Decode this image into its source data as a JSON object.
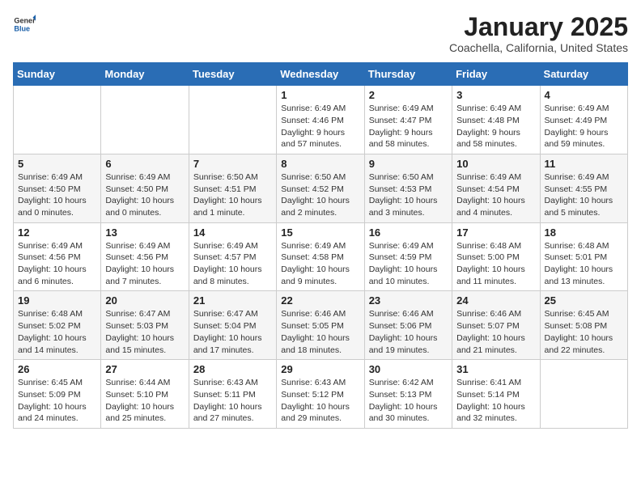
{
  "logo": {
    "general": "General",
    "blue": "Blue"
  },
  "header": {
    "month": "January 2025",
    "location": "Coachella, California, United States"
  },
  "weekdays": [
    "Sunday",
    "Monday",
    "Tuesday",
    "Wednesday",
    "Thursday",
    "Friday",
    "Saturday"
  ],
  "weeks": [
    [
      {
        "day": null
      },
      {
        "day": null
      },
      {
        "day": null
      },
      {
        "day": 1,
        "sunrise": "Sunrise: 6:49 AM",
        "sunset": "Sunset: 4:46 PM",
        "daylight": "Daylight: 9 hours and 57 minutes."
      },
      {
        "day": 2,
        "sunrise": "Sunrise: 6:49 AM",
        "sunset": "Sunset: 4:47 PM",
        "daylight": "Daylight: 9 hours and 58 minutes."
      },
      {
        "day": 3,
        "sunrise": "Sunrise: 6:49 AM",
        "sunset": "Sunset: 4:48 PM",
        "daylight": "Daylight: 9 hours and 58 minutes."
      },
      {
        "day": 4,
        "sunrise": "Sunrise: 6:49 AM",
        "sunset": "Sunset: 4:49 PM",
        "daylight": "Daylight: 9 hours and 59 minutes."
      }
    ],
    [
      {
        "day": 5,
        "sunrise": "Sunrise: 6:49 AM",
        "sunset": "Sunset: 4:50 PM",
        "daylight": "Daylight: 10 hours and 0 minutes."
      },
      {
        "day": 6,
        "sunrise": "Sunrise: 6:49 AM",
        "sunset": "Sunset: 4:50 PM",
        "daylight": "Daylight: 10 hours and 0 minutes."
      },
      {
        "day": 7,
        "sunrise": "Sunrise: 6:50 AM",
        "sunset": "Sunset: 4:51 PM",
        "daylight": "Daylight: 10 hours and 1 minute."
      },
      {
        "day": 8,
        "sunrise": "Sunrise: 6:50 AM",
        "sunset": "Sunset: 4:52 PM",
        "daylight": "Daylight: 10 hours and 2 minutes."
      },
      {
        "day": 9,
        "sunrise": "Sunrise: 6:50 AM",
        "sunset": "Sunset: 4:53 PM",
        "daylight": "Daylight: 10 hours and 3 minutes."
      },
      {
        "day": 10,
        "sunrise": "Sunrise: 6:49 AM",
        "sunset": "Sunset: 4:54 PM",
        "daylight": "Daylight: 10 hours and 4 minutes."
      },
      {
        "day": 11,
        "sunrise": "Sunrise: 6:49 AM",
        "sunset": "Sunset: 4:55 PM",
        "daylight": "Daylight: 10 hours and 5 minutes."
      }
    ],
    [
      {
        "day": 12,
        "sunrise": "Sunrise: 6:49 AM",
        "sunset": "Sunset: 4:56 PM",
        "daylight": "Daylight: 10 hours and 6 minutes."
      },
      {
        "day": 13,
        "sunrise": "Sunrise: 6:49 AM",
        "sunset": "Sunset: 4:56 PM",
        "daylight": "Daylight: 10 hours and 7 minutes."
      },
      {
        "day": 14,
        "sunrise": "Sunrise: 6:49 AM",
        "sunset": "Sunset: 4:57 PM",
        "daylight": "Daylight: 10 hours and 8 minutes."
      },
      {
        "day": 15,
        "sunrise": "Sunrise: 6:49 AM",
        "sunset": "Sunset: 4:58 PM",
        "daylight": "Daylight: 10 hours and 9 minutes."
      },
      {
        "day": 16,
        "sunrise": "Sunrise: 6:49 AM",
        "sunset": "Sunset: 4:59 PM",
        "daylight": "Daylight: 10 hours and 10 minutes."
      },
      {
        "day": 17,
        "sunrise": "Sunrise: 6:48 AM",
        "sunset": "Sunset: 5:00 PM",
        "daylight": "Daylight: 10 hours and 11 minutes."
      },
      {
        "day": 18,
        "sunrise": "Sunrise: 6:48 AM",
        "sunset": "Sunset: 5:01 PM",
        "daylight": "Daylight: 10 hours and 13 minutes."
      }
    ],
    [
      {
        "day": 19,
        "sunrise": "Sunrise: 6:48 AM",
        "sunset": "Sunset: 5:02 PM",
        "daylight": "Daylight: 10 hours and 14 minutes."
      },
      {
        "day": 20,
        "sunrise": "Sunrise: 6:47 AM",
        "sunset": "Sunset: 5:03 PM",
        "daylight": "Daylight: 10 hours and 15 minutes."
      },
      {
        "day": 21,
        "sunrise": "Sunrise: 6:47 AM",
        "sunset": "Sunset: 5:04 PM",
        "daylight": "Daylight: 10 hours and 17 minutes."
      },
      {
        "day": 22,
        "sunrise": "Sunrise: 6:46 AM",
        "sunset": "Sunset: 5:05 PM",
        "daylight": "Daylight: 10 hours and 18 minutes."
      },
      {
        "day": 23,
        "sunrise": "Sunrise: 6:46 AM",
        "sunset": "Sunset: 5:06 PM",
        "daylight": "Daylight: 10 hours and 19 minutes."
      },
      {
        "day": 24,
        "sunrise": "Sunrise: 6:46 AM",
        "sunset": "Sunset: 5:07 PM",
        "daylight": "Daylight: 10 hours and 21 minutes."
      },
      {
        "day": 25,
        "sunrise": "Sunrise: 6:45 AM",
        "sunset": "Sunset: 5:08 PM",
        "daylight": "Daylight: 10 hours and 22 minutes."
      }
    ],
    [
      {
        "day": 26,
        "sunrise": "Sunrise: 6:45 AM",
        "sunset": "Sunset: 5:09 PM",
        "daylight": "Daylight: 10 hours and 24 minutes."
      },
      {
        "day": 27,
        "sunrise": "Sunrise: 6:44 AM",
        "sunset": "Sunset: 5:10 PM",
        "daylight": "Daylight: 10 hours and 25 minutes."
      },
      {
        "day": 28,
        "sunrise": "Sunrise: 6:43 AM",
        "sunset": "Sunset: 5:11 PM",
        "daylight": "Daylight: 10 hours and 27 minutes."
      },
      {
        "day": 29,
        "sunrise": "Sunrise: 6:43 AM",
        "sunset": "Sunset: 5:12 PM",
        "daylight": "Daylight: 10 hours and 29 minutes."
      },
      {
        "day": 30,
        "sunrise": "Sunrise: 6:42 AM",
        "sunset": "Sunset: 5:13 PM",
        "daylight": "Daylight: 10 hours and 30 minutes."
      },
      {
        "day": 31,
        "sunrise": "Sunrise: 6:41 AM",
        "sunset": "Sunset: 5:14 PM",
        "daylight": "Daylight: 10 hours and 32 minutes."
      },
      {
        "day": null
      }
    ]
  ]
}
